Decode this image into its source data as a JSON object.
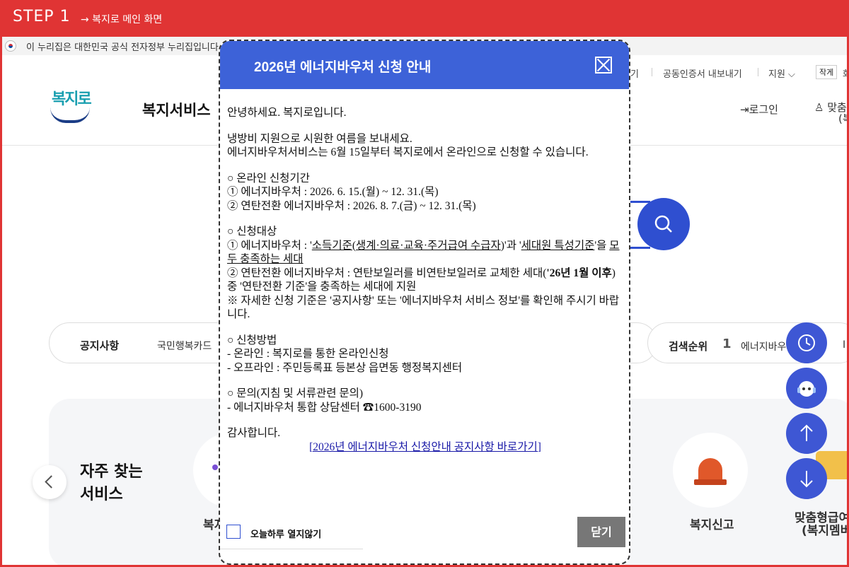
{
  "step": {
    "title": "STEP 1",
    "subtitle": "→ 복지로 메인 화면"
  },
  "site": {
    "gov_banner": "이 누리집은 대한민국 공식 전자정부 누리집입니다.",
    "util_items": [
      "기",
      "공동인증서 내보내기",
      "지원 ⌵",
      "작게",
      "화"
    ],
    "logo_text": "복지로",
    "gnb_main": "복지서비스",
    "login": "로그인",
    "custom_service": [
      "맞춤",
      "(복"
    ],
    "notice": {
      "label": "공지사항",
      "text": "국민행복카드"
    },
    "ranking": {
      "label": "검색순위",
      "rank": "1",
      "keyword": "에너지바우",
      "extra": "I"
    },
    "favorites": {
      "title_line1": "자주 찾는",
      "title_line2": "서비스",
      "items": [
        "복지",
        "복지신고",
        "맞춤형급여",
        "(복지멤버"
      ]
    }
  },
  "modal": {
    "title": "2026년 에너지바우처 신청 안내",
    "greeting": "안녕하세요. 복지로입니다.",
    "intro1": "냉방비 지원으로 시원한 여름을 보내세요.",
    "intro2": "에너지바우처서비스는 6월 15일부터 복지로에서 온라인으로 신청할 수 있습니다.",
    "period_head": "○ 온라인 신청기간",
    "period1": "① 에너지바우처 : 2026. 6. 15.(월) ~ 12. 31.(목)",
    "period2": "② 연탄전환 에너지바우처 : 2026. 8. 7.(금) ~ 12. 31.(목)",
    "target_head": "○ 신청대상",
    "target1_a": "① 에너지바우처 : '",
    "target1_b": "소득기준(생계·의료·교육·주거급여 수급자",
    "target1_c": ")'과 '",
    "target1_d": "세대원 특성기준",
    "target1_e": "'을 ",
    "target1_f": "모두 충족하는 세대",
    "target2_a": "② 연탄전환 에너지바우처 : 연탄보일러를 비연탄보일러로 교체한 세대(",
    "target2_b": "'26년 1월 이후",
    "target2_c": ") 중 '연탄전환 기준'을 충족하는 세대에 지원",
    "target_note": "※ 자세한 신청 기준은 '공지사항' 또는 '에너지바우처 서비스 정보'를 확인해 주시기 바랍니다.",
    "method_head": "○ 신청방법",
    "method1": " - 온라인 : 복지로를 통한 온라인신청",
    "method2": " - 오프라인 : 주민등록표 등본상 읍면동 행정복지센터",
    "contact_head": "○ 문의(지침 및 서류관련 문의)",
    "contact1": " - 에너지바우처 통합 상담센터 ☎1600-3190",
    "thanks": "감사합니다.",
    "link": "[2026년 에너지바우처 신청안내 공지사항 바로가기]",
    "checkbox_label": "오늘하루 열지않기",
    "close_label": "닫기"
  },
  "colors": {
    "step_bar": "#e03434",
    "modal_header": "#3d62d8",
    "fab": "#3e57d4"
  }
}
